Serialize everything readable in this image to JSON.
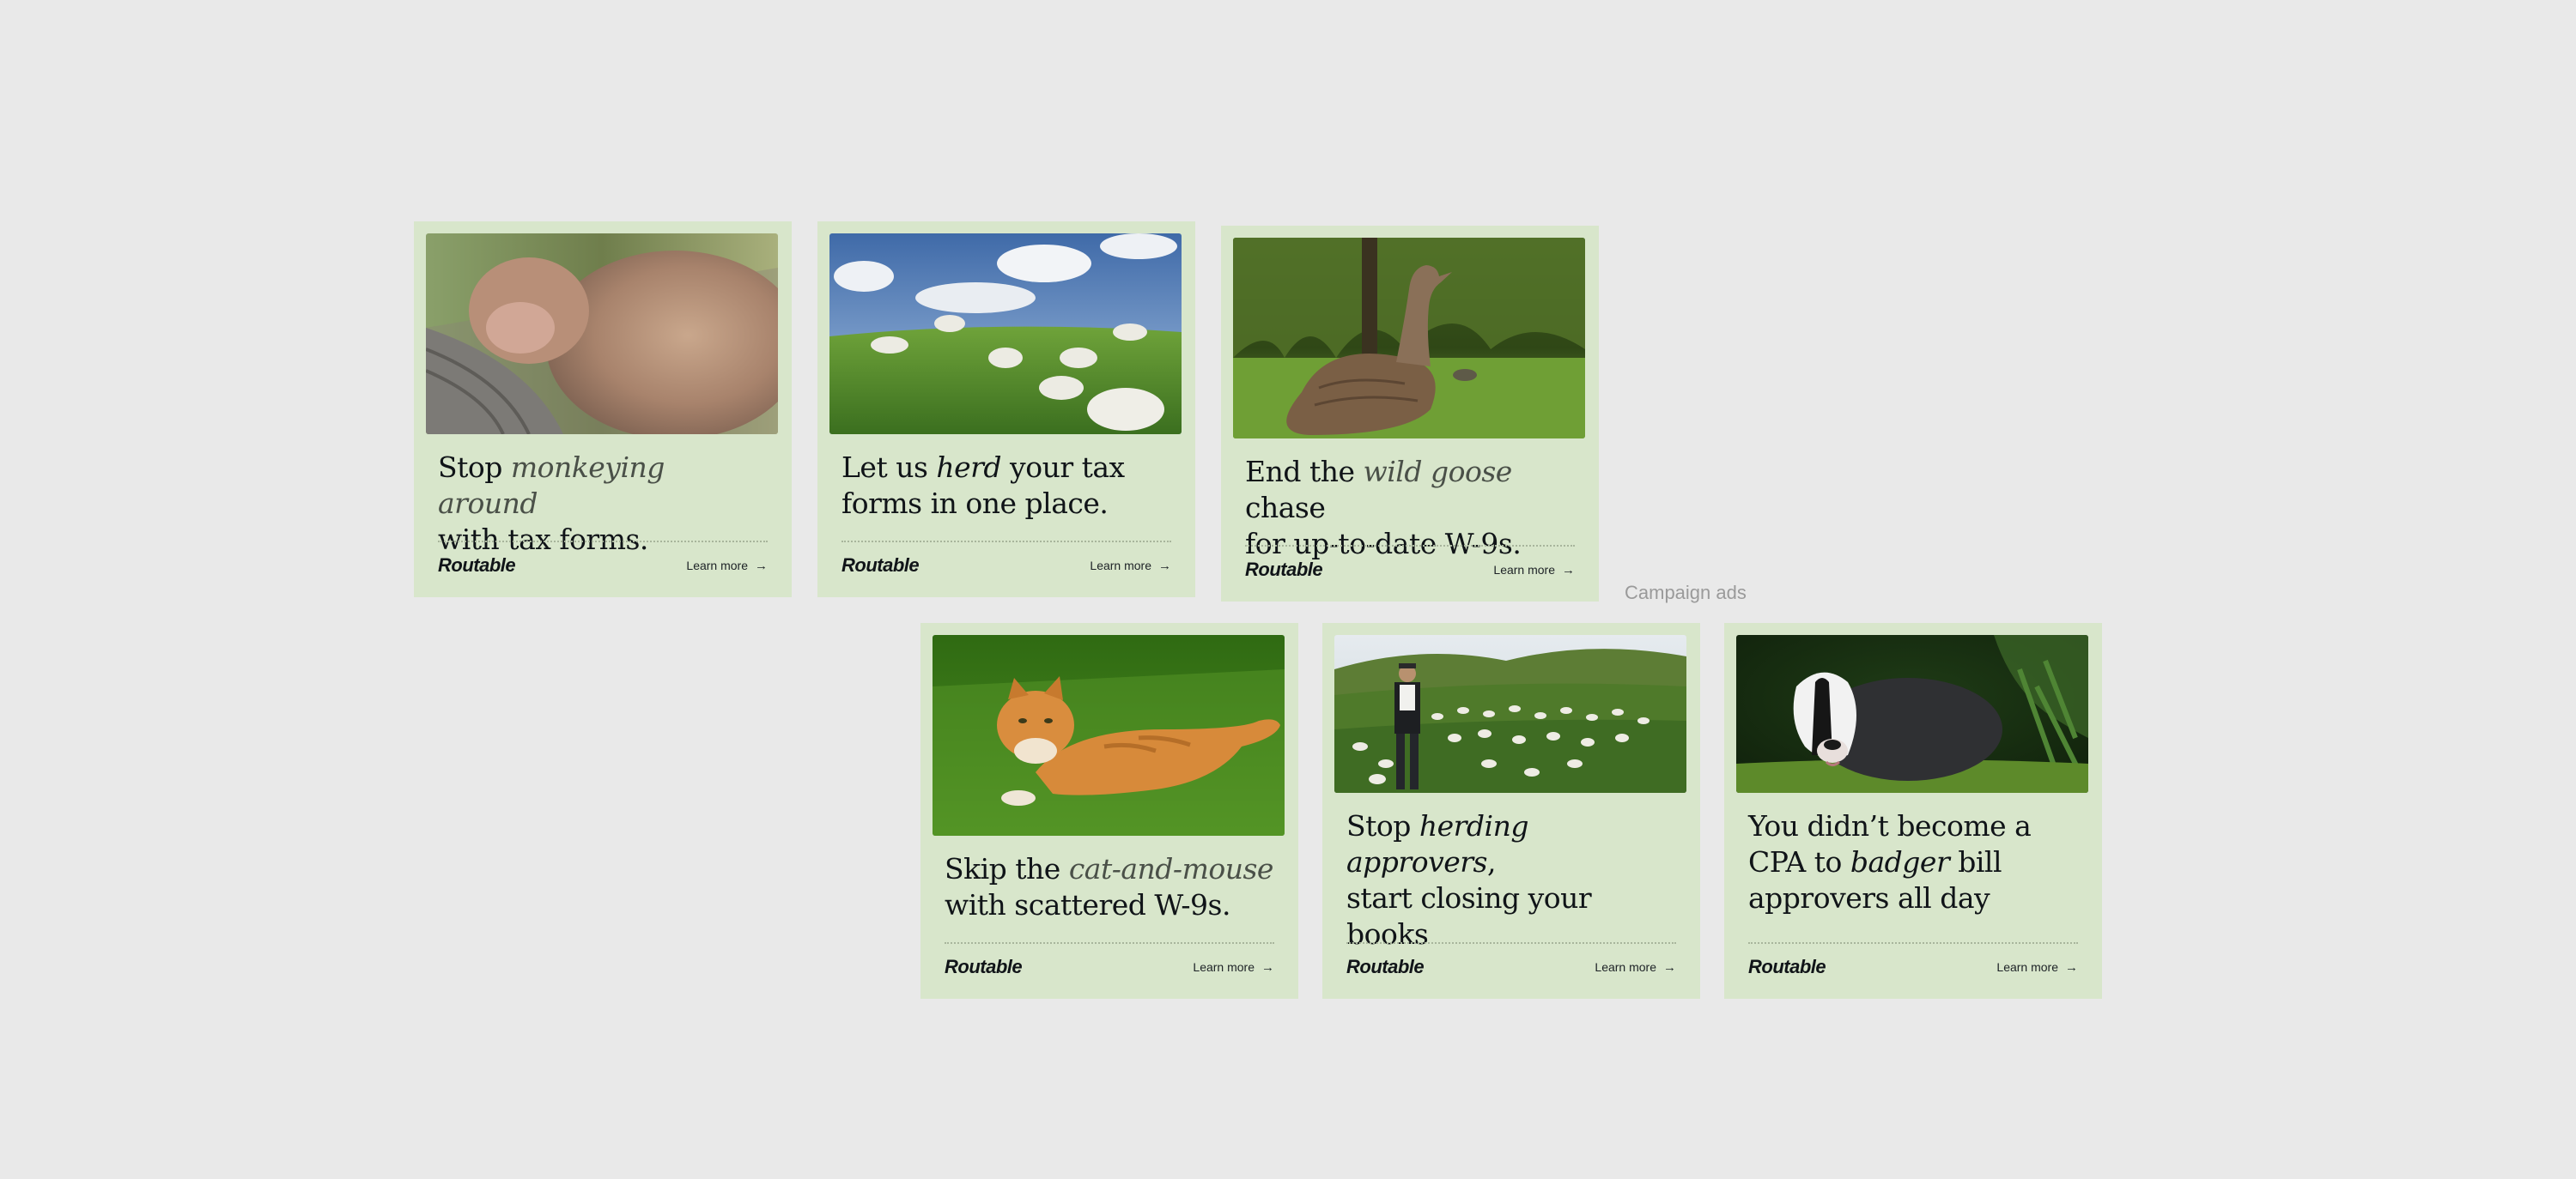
{
  "caption": "Campaign ads",
  "brand": "Routable",
  "cta": "Learn more",
  "cards": [
    {
      "pre": "Stop ",
      "em": "monkeying around",
      "post": "",
      "line2": "with tax forms.",
      "image": "sleeping-monkey"
    },
    {
      "pre": "Let us ",
      "em": "herd",
      "post": " your tax",
      "line2": "forms in one place.",
      "image": "sheep-field"
    },
    {
      "pre": "End the ",
      "em": "wild goose",
      "post": " chase",
      "line2": "for up-to-date W-9s.",
      "image": "goose"
    },
    {
      "pre": "Skip the ",
      "em": "cat-and-mouse",
      "post": "",
      "line2": "with scattered W-9s.",
      "image": "orange-cat"
    },
    {
      "pre": "Stop ",
      "em": "herding approvers",
      "post": ",",
      "line2": "start closing your",
      "line3": "books",
      "image": "shepherd"
    },
    {
      "pre": "You didn’t become a",
      "line2a": "CPA to ",
      "em": "badger",
      "line2b": " bill",
      "line3": "approvers all day",
      "image": "badger"
    }
  ]
}
